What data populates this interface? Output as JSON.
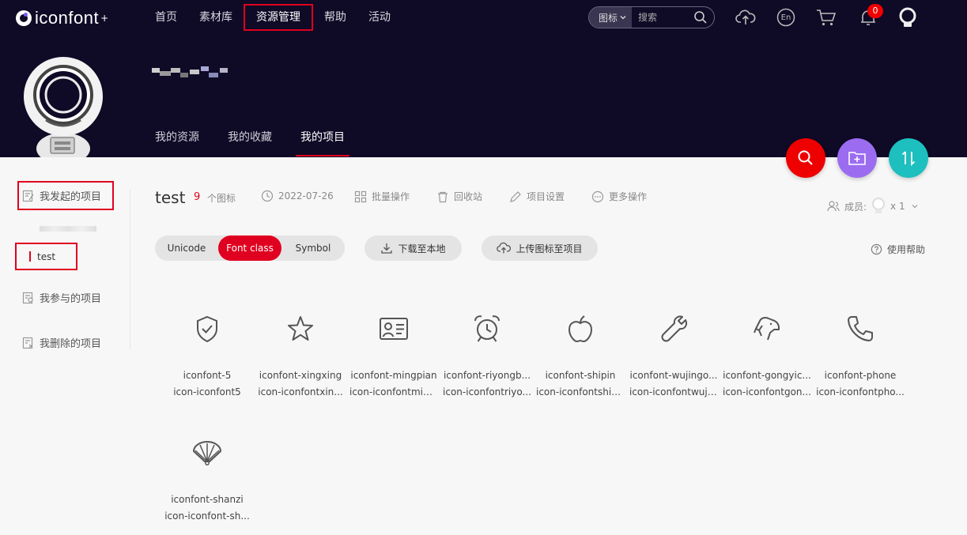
{
  "header": {
    "logo_text": "iconfont",
    "logo_plus": "+",
    "nav": [
      "首页",
      "素材库",
      "资源管理",
      "帮助",
      "活动"
    ],
    "active_nav": "资源管理",
    "search": {
      "type_label": "图标",
      "placeholder": "搜索"
    },
    "notification_count": "0",
    "lang_label": "En"
  },
  "profile": {
    "tabs": [
      "我的资源",
      "我的收藏",
      "我的项目"
    ],
    "active_tab": "我的项目"
  },
  "sidebar": {
    "my_projects": "我发起的项目",
    "project_name": "test",
    "joined": "我参与的项目",
    "deleted": "我删除的项目"
  },
  "project": {
    "title": "test",
    "icon_count": "9",
    "icon_count_label": "个图标",
    "date": "2022-07-26",
    "batch": "批量操作",
    "recycle": "回收站",
    "settings": "项目设置",
    "more": "更多操作",
    "members_label": "成员:",
    "members_count": "x 1",
    "formats": [
      "Unicode",
      "Font class",
      "Symbol"
    ],
    "active_format": "Font class",
    "download": "下载至本地",
    "upload": "上传图标至项目",
    "help": "使用帮助"
  },
  "icons": [
    {
      "name": "iconfont-5",
      "code": "icon-iconfont5",
      "glyph": "shield-check-icon"
    },
    {
      "name": "iconfont-xingxing",
      "code": "icon-iconfontxin...",
      "glyph": "star-icon"
    },
    {
      "name": "iconfont-mingpian",
      "code": "icon-iconfontmin...",
      "glyph": "business-card-icon"
    },
    {
      "name": "iconfont-riyongb...",
      "code": "icon-iconfontriyo...",
      "glyph": "alarm-clock-icon"
    },
    {
      "name": "iconfont-shipin",
      "code": "icon-iconfontshipin",
      "glyph": "apple-icon"
    },
    {
      "name": "iconfont-wujingo...",
      "code": "icon-iconfontwuji...",
      "glyph": "wrench-icon"
    },
    {
      "name": "iconfont-gongyic...",
      "code": "icon-iconfontgon...",
      "glyph": "dog-icon"
    },
    {
      "name": "iconfont-phone",
      "code": "icon-iconfontpho...",
      "glyph": "phone-icon"
    },
    {
      "name": "iconfont-shanzi",
      "code": "icon-iconfont-sh...",
      "glyph": "fan-icon"
    }
  ],
  "colors": {
    "header_bg": "#0f0a26",
    "accent_red": "#e0001f",
    "fab_search": "#ee0000",
    "fab_new": "#9b6cf0",
    "fab_sort": "#1dbfbf"
  }
}
